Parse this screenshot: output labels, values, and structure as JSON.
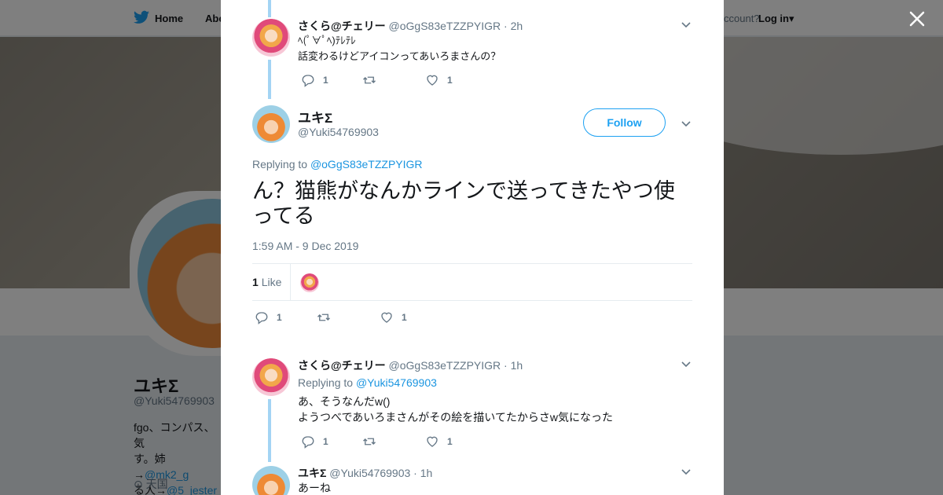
{
  "nav": {
    "home": "Home",
    "about": "Abo",
    "account": "ccount?",
    "login": "Log in"
  },
  "profile": {
    "name": "ユキΣ",
    "handle": "@Yuki54769903",
    "bio_line1": "fgo、コンパス、気",
    "bio_line2a": "す。姉→",
    "bio_link1": "@mk2_g",
    "bio_line3a": "る人→",
    "bio_link2": "@5_jester",
    "location": "天国"
  },
  "tweets": [
    {
      "name": "さくら@チェリー",
      "handle": "@oGgS83eTZZPYIGR",
      "time": "· 2h",
      "text": "ﾍ(ﾟ∀ﾟﾍ)ﾃﾚﾃﾚ\n話変わるけどアイコンってあいろまさんの？",
      "replies": "1",
      "retweets": "",
      "likes": "1"
    },
    {
      "name": "さくら@チェリー",
      "handle": "@oGgS83eTZZPYIGR",
      "time": "· 1h",
      "replying_label": "Replying to",
      "replying_to": "@Yuki54769903",
      "text": "あ、そうなんだw()\nようつべであいろまさんがその絵を描いてたからさw気になった",
      "replies": "1",
      "retweets": "",
      "likes": "1"
    },
    {
      "name": "ユキΣ",
      "handle": "@Yuki54769903",
      "time": "· 1h",
      "text": "あーね"
    }
  ],
  "main_tweet": {
    "name": "ユキΣ",
    "handle": "@Yuki54769903",
    "follow": "Follow",
    "replying_label": "Replying to",
    "replying_to": "@oGgS83eTZZPYIGR",
    "text": "ん？猫熊がなんかラインで送ってきたやつ使ってる",
    "timestamp": "1:59 AM - 9 Dec 2019",
    "like_count": "1",
    "like_label": "Like",
    "replies": "1",
    "retweets": "",
    "likes": "1"
  },
  "colors": {
    "accent": "#1da1f2",
    "link": "#1b95e0",
    "thread_line": "#a3d4f4"
  }
}
